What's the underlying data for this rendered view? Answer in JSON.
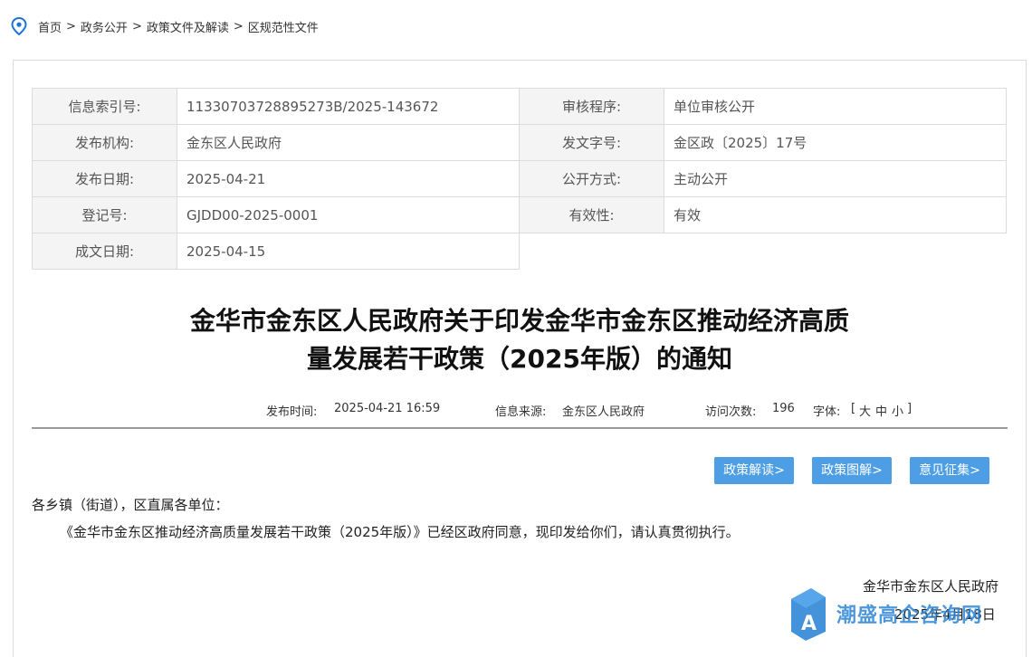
{
  "breadcrumb": {
    "items": [
      "首页",
      "政务公开",
      "政策文件及解读",
      "区规范性文件"
    ],
    "separator": ">"
  },
  "meta": {
    "rows": [
      {
        "l1": "信息索引号:",
        "v1": "11330703728895273B/2025-143672",
        "l2": "审核程序:",
        "v2": "单位审核公开"
      },
      {
        "l1": "发布机构:",
        "v1": "金东区人民政府",
        "l2": "发文字号:",
        "v2": "金区政〔2025〕17号"
      },
      {
        "l1": "发布日期:",
        "v1": "2025-04-21",
        "l2": "公开方式:",
        "v2": "主动公开"
      },
      {
        "l1": "登记号:",
        "v1": "GJDD00-2025-0001",
        "l2": "有效性:",
        "v2": "有效"
      },
      {
        "l1": "成文日期:",
        "v1": "2025-04-15"
      }
    ]
  },
  "title": {
    "line1": "金华市金东区人民政府关于印发金华市金东区推动经济高质",
    "line2": "量发展若干政策（2025年版）的通知"
  },
  "info": {
    "publish_time_label": "发布时间:",
    "publish_time": "2025-04-21 16:59",
    "source_label": "信息来源:",
    "source": "金东区人民政府",
    "visits_label": "访问次数:",
    "visits": "196",
    "font_label": "字体:",
    "font_open": "[",
    "font_large": "大",
    "font_medium": "中",
    "font_small": "小",
    "font_close": "]"
  },
  "buttons": {
    "policy_interpret": "政策解读>",
    "policy_graphic": "政策图解>",
    "opinion": "意见征集>"
  },
  "content": {
    "salutation": "各乡镇（街道），区直属各单位：",
    "paragraph": "《金华市金东区推动经济高质量发展若干政策（2025年版）》已经区政府同意，现印发给你们，请认真贯彻执行。",
    "signature": "金华市金东区人民政府",
    "date": "2025年4月18日"
  },
  "watermark": {
    "text": "潮盛高企咨询网",
    "logo_letter": "A"
  },
  "colors": {
    "button_bg": "#4d9ee4",
    "label_bg": "#f4f4f4",
    "border": "#dcdcdc",
    "location_icon": "#1a73d9"
  }
}
